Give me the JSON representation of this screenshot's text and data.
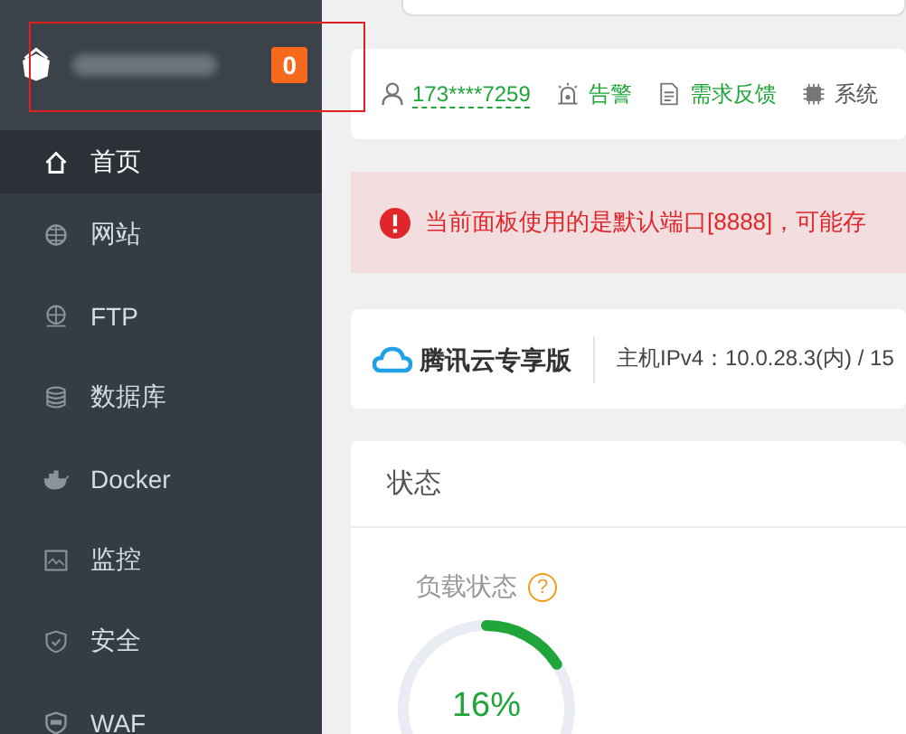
{
  "sidebar": {
    "badge": "0",
    "items": [
      {
        "label": "首页",
        "selected": true
      },
      {
        "label": "网站",
        "selected": false
      },
      {
        "label": "FTP",
        "selected": false
      },
      {
        "label": "数据库",
        "selected": false
      },
      {
        "label": "Docker",
        "selected": false
      },
      {
        "label": "监控",
        "selected": false
      },
      {
        "label": "安全",
        "selected": false
      },
      {
        "label": "WAF",
        "selected": false
      }
    ]
  },
  "user_bar": {
    "phone": "173****7259",
    "links": [
      {
        "label": "告警"
      },
      {
        "label": "需求反馈"
      },
      {
        "label": "系统"
      }
    ]
  },
  "alert": {
    "text": "当前面板使用的是默认端口[8888]，可能存"
  },
  "server": {
    "brand": "腾讯云专享版",
    "info": "主机IPv4：10.0.28.3(内) / 15"
  },
  "status": {
    "title": "状态",
    "load": {
      "label": "负载状态",
      "help": "?",
      "level": 0.16,
      "reading": "16%"
    }
  }
}
